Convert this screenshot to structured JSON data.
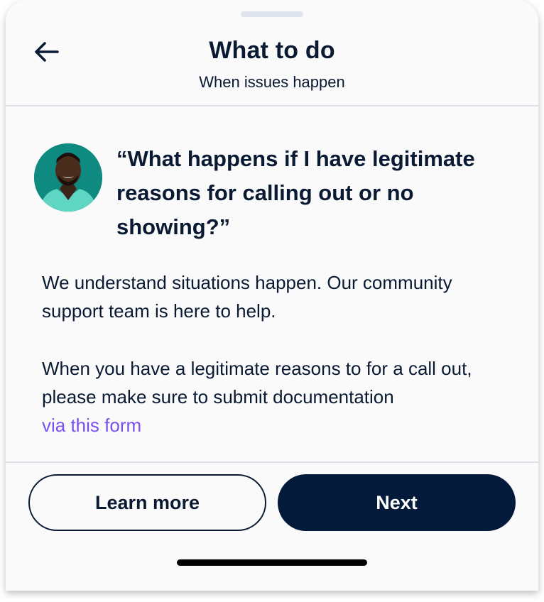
{
  "header": {
    "title": "What to do",
    "subtitle": "When issues happen"
  },
  "content": {
    "question": "“What happens if I have legitimate reasons for calling out or no showing?”",
    "paragraph_1": "We understand situations happen. Our community support team is here to help.",
    "paragraph_2": "When you have a legitimate reasons to for a call out, please make sure to submit documentation",
    "link_text": "via this form"
  },
  "actions": {
    "learn_more_label": "Learn more",
    "next_label": "Next"
  },
  "colors": {
    "text": "#0b1a33",
    "link": "#7a4ff0",
    "primary_button": "#031a3a",
    "avatar_background": "#0f8a80"
  },
  "icons": {
    "back": "arrow-left-icon"
  }
}
